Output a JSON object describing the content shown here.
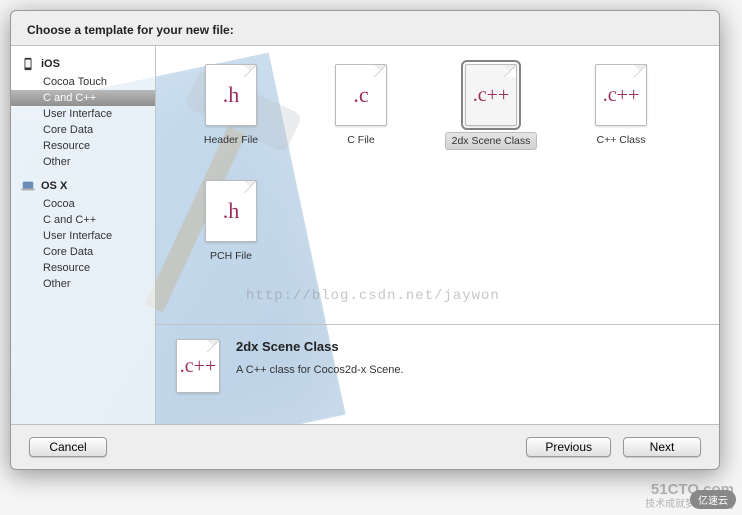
{
  "header": {
    "title": "Choose a template for your new file:"
  },
  "sidebar": {
    "sections": [
      {
        "name": "iOS",
        "items": [
          "Cocoa Touch",
          "C and C++",
          "User Interface",
          "Core Data",
          "Resource",
          "Other"
        ],
        "selected_index": 1
      },
      {
        "name": "OS X",
        "items": [
          "Cocoa",
          "C and C++",
          "User Interface",
          "Core Data",
          "Resource",
          "Other"
        ],
        "selected_index": -1
      }
    ]
  },
  "templates": [
    {
      "glyph": ".h",
      "label": "Header File",
      "selected": false
    },
    {
      "glyph": ".c",
      "label": "C File",
      "selected": false
    },
    {
      "glyph": ".c++",
      "label": "2dx Scene Class",
      "selected": true
    },
    {
      "glyph": ".c++",
      "label": "C++ Class",
      "selected": false
    },
    {
      "glyph": ".h",
      "label": "PCH File",
      "selected": false
    }
  ],
  "detail": {
    "glyph": ".c++",
    "title": "2dx Scene Class",
    "desc": "A C++ class for Cocos2d-x Scene."
  },
  "footer": {
    "cancel": "Cancel",
    "previous": "Previous",
    "next": "Next"
  },
  "watermark": "http://blog.csdn.net/jaywon",
  "corner": {
    "line1": "51CTO.com",
    "line2": "技术成就梦想 · Blog"
  },
  "badge": "亿速云"
}
